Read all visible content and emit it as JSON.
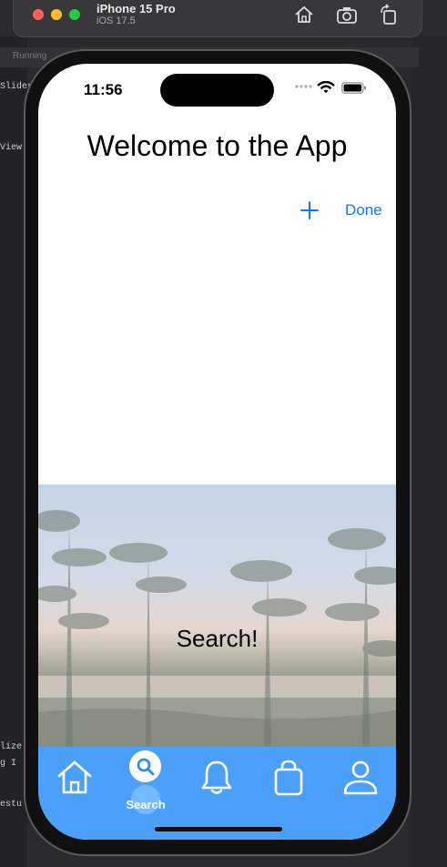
{
  "simulator": {
    "device_name": "iPhone 15 Pro",
    "os_version": "iOS 17.5",
    "toolbar": [
      "home-icon",
      "screenshot-icon",
      "rotate-icon"
    ]
  },
  "background": {
    "tab_text": "Running",
    "chip_slider": "Slider(",
    "chip_view": "View",
    "chip_lize": "lize",
    "chip_ig": "g I",
    "chip_estu": "estu"
  },
  "status_bar": {
    "time": "11:56"
  },
  "screen": {
    "title": "Welcome to the App",
    "nav": {
      "add_icon": "plus-icon",
      "done_label": "Done"
    },
    "hero_label": "Search!"
  },
  "tab_bar": {
    "items": [
      {
        "icon": "home-icon",
        "label": ""
      },
      {
        "icon": "search-icon",
        "label": "Search",
        "selected": true
      },
      {
        "icon": "bell-icon",
        "label": ""
      },
      {
        "icon": "bag-icon",
        "label": ""
      },
      {
        "icon": "person-icon",
        "label": ""
      }
    ],
    "selected_label": "Search",
    "background_color": "#4ba0fb"
  },
  "colors": {
    "accent": "#0a7aff",
    "tab_bar": "#4ba0fb"
  }
}
